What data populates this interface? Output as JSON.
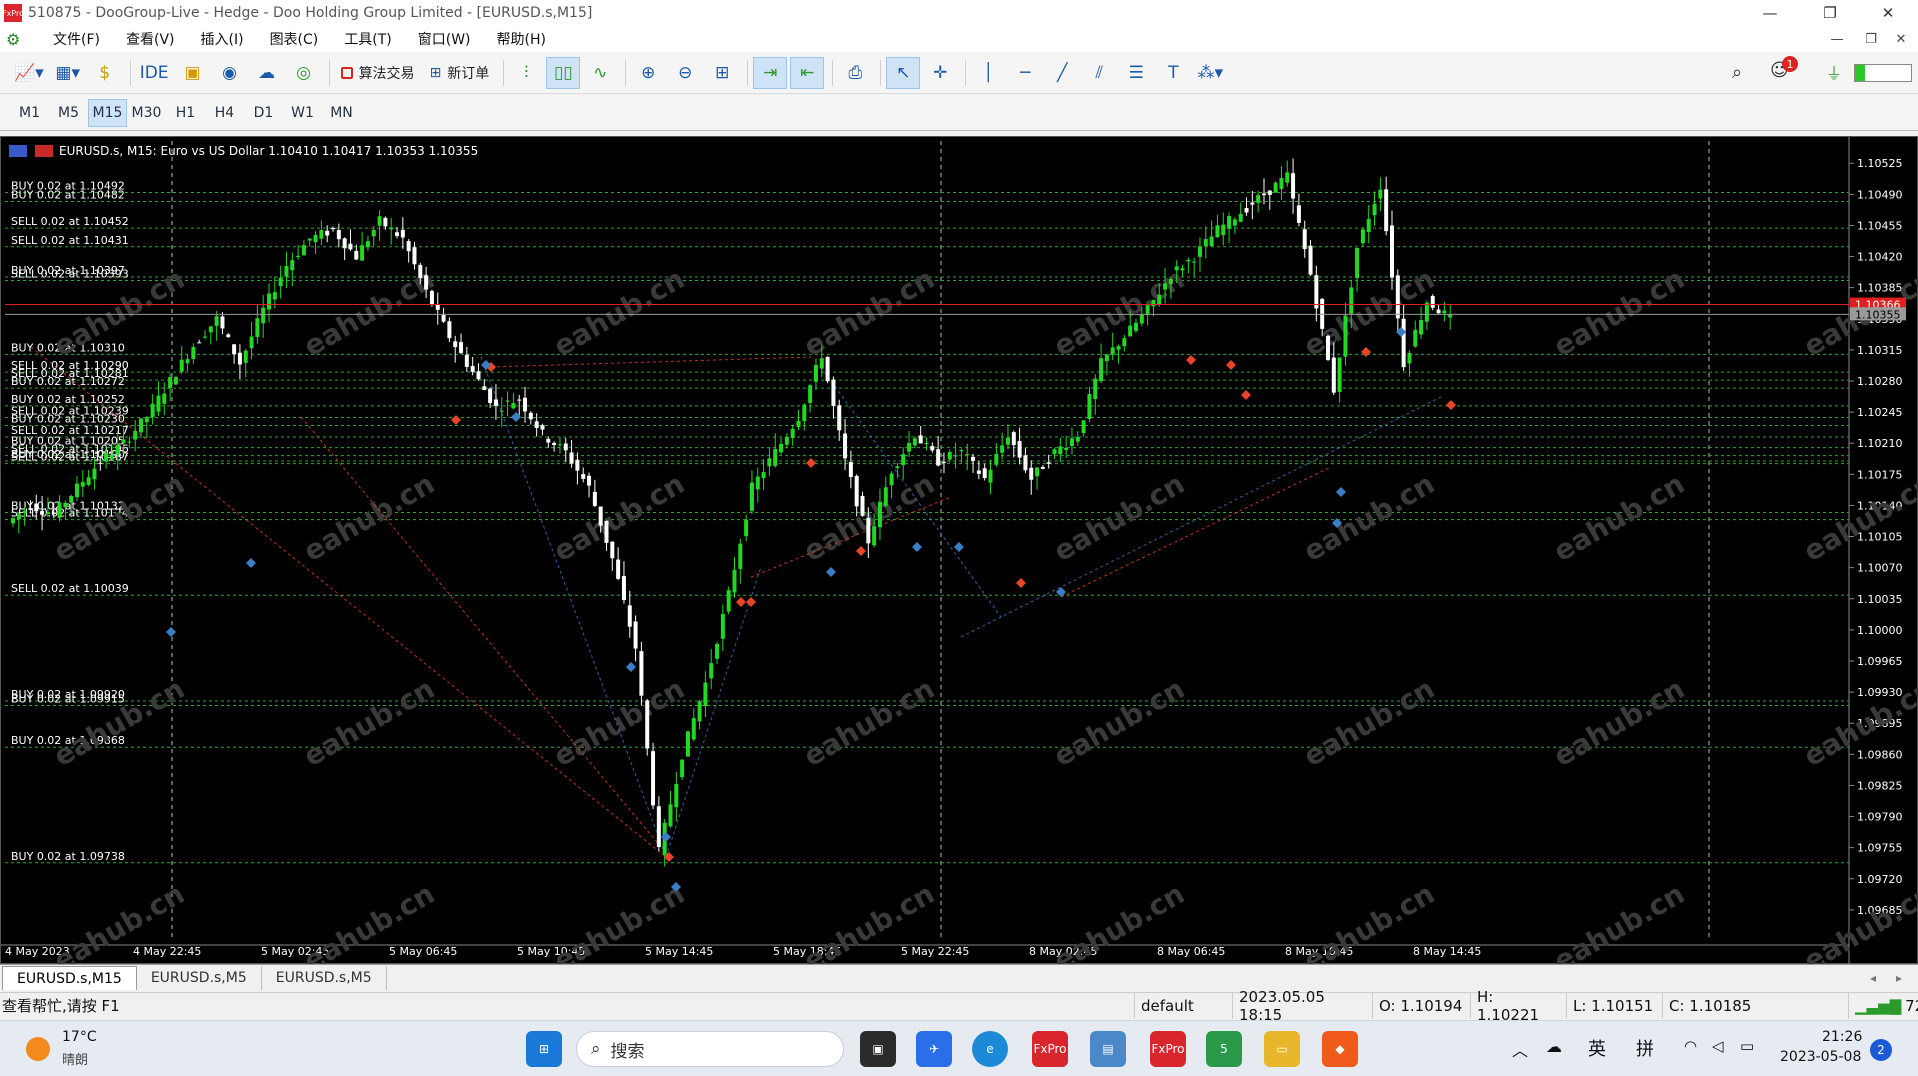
{
  "titlebar": {
    "title": "510875 - DooGroup-Live - Hedge - Doo Holding Group Limited - [EURUSD.s,M15]",
    "min": "—",
    "restore": "❐",
    "close": "✕"
  },
  "menu": {
    "items": [
      "文件(F)",
      "查看(V)",
      "插入(I)",
      "图表(C)",
      "工具(T)",
      "窗口(W)",
      "帮助(H)"
    ],
    "doc_min": "—",
    "doc_restore": "❐",
    "doc_close": "✕"
  },
  "toolbar": {
    "ide": "IDE",
    "algo_trading": "算法交易",
    "new_order": "新订单",
    "notif_count": "1"
  },
  "timeframes": {
    "items": [
      "M1",
      "M5",
      "M15",
      "M30",
      "H1",
      "H4",
      "D1",
      "W1",
      "MN"
    ],
    "active": "M15"
  },
  "chart_data": {
    "type": "candlestick",
    "symbol_header": "EURUSD.s, M15:  Euro vs US Dollar  1.10410 1.10417 1.10353 1.10355",
    "ylim": [
      1.0965,
      1.1055
    ],
    "y_ticks": [
      "1.10525",
      "1.10490",
      "1.10455",
      "1.10420",
      "1.10385",
      "1.10350",
      "1.10315",
      "1.10280",
      "1.10245",
      "1.10210",
      "1.10175",
      "1.10140",
      "1.10105",
      "1.10070",
      "1.10035",
      "1.10000",
      "1.09965",
      "1.09930",
      "1.09895",
      "1.09860",
      "1.09825",
      "1.09790",
      "1.09755",
      "1.09720",
      "1.09685"
    ],
    "x_ticks": [
      "4 May 2023",
      "4 May 22:45",
      "5 May 02:45",
      "5 May 06:45",
      "5 May 10:45",
      "5 May 14:45",
      "5 May 18:45",
      "5 May 22:45",
      "8 May 02:45",
      "8 May 06:45",
      "8 May 10:45",
      "8 May 14:45"
    ],
    "price_labels": {
      "ask": "1.10366",
      "bid": "1.10355"
    },
    "order_lines": [
      {
        "label": "BUY 0.02 at 1.10492",
        "price": 1.10492
      },
      {
        "label": "BUY 0.02 at 1.10482",
        "price": 1.10482
      },
      {
        "label": "SELL 0.02 at 1.10452",
        "price": 1.10452
      },
      {
        "label": "SELL 0.02 at 1.10431",
        "price": 1.10431
      },
      {
        "label": "BUY 0.02 at 1.10397",
        "price": 1.10397
      },
      {
        "label": "SELL 0.02 at 1.10393",
        "price": 1.10393
      },
      {
        "label": "BUY 0.02 at 1.10310",
        "price": 1.1031
      },
      {
        "label": "SELL 0.02 at 1.10290",
        "price": 1.1029
      },
      {
        "label": "SELL 0.02 at 1.10281",
        "price": 1.10281
      },
      {
        "label": "BUY 0.02 at 1.10272",
        "price": 1.10272
      },
      {
        "label": "BUY 0.02 at 1.10252",
        "price": 1.10252
      },
      {
        "label": "SELL 0.02 at 1.10239",
        "price": 1.10239
      },
      {
        "label": "BUY 0.02 at 1.10230",
        "price": 1.1023
      },
      {
        "label": "SELL 0.02 at 1.10217",
        "price": 1.10217
      },
      {
        "label": "BUY 0.02 at 1.10205",
        "price": 1.10205
      },
      {
        "label": "SELL 0.02 at 1.10196",
        "price": 1.10196
      },
      {
        "label": "BUY 0.02 at 1.10190",
        "price": 1.1019
      },
      {
        "label": "SELL 0.02 at 1.10187",
        "price": 1.10187
      },
      {
        "label": "BUY 0.02 at 1.10132",
        "price": 1.10132
      },
      {
        "label": "SELL 0.02 at 1.10124",
        "price": 1.10124
      },
      {
        "label": "SELL 0.02 at 1.10039",
        "price": 1.10039
      },
      {
        "label": "BUY 0.02 at 1.09920",
        "price": 1.0992
      },
      {
        "label": "BUY 0.02 at 1.09915",
        "price": 1.09915
      },
      {
        "label": "BUY 0.02 at 1.09868",
        "price": 1.09868
      },
      {
        "label": "BUY 0.02 at 1.09738",
        "price": 1.09738
      }
    ],
    "close_path": [
      1.1012,
      1.1014,
      1.1013,
      1.1016,
      1.1019,
      1.1021,
      1.1024,
      1.1028,
      1.1032,
      1.1035,
      1.103,
      1.1036,
      1.1041,
      1.1044,
      1.1045,
      1.1042,
      1.1046,
      1.1044,
      1.1038,
      1.1033,
      1.1029,
      1.1025,
      1.1026,
      1.1022,
      1.102,
      1.1016,
      1.1008,
      1.0998,
      1.0975,
      1.0986,
      1.0994,
      1.1004,
      1.1016,
      1.102,
      1.1024,
      1.1031,
      1.1019,
      1.101,
      1.1018,
      1.1022,
      1.1019,
      1.102,
      1.1017,
      1.1022,
      1.1017,
      1.102,
      1.1022,
      1.103,
      1.1033,
      1.1036,
      1.104,
      1.1042,
      1.1045,
      1.1047,
      1.1049,
      1.1051,
      1.104,
      1.1027,
      1.1043,
      1.105,
      1.103,
      1.1037,
      1.1035
    ],
    "colors": {
      "bull": "#22d822",
      "bear": "#ffffff",
      "grid": "#4a4a4a",
      "order_line": "#2ea82e",
      "buy": "#3a7ec8",
      "sell": "#e8442a"
    }
  },
  "watermark": "eahub.cn",
  "tabs": [
    "EURUSD.s,M15",
    "EURUSD.s,M5",
    "EURUSD.s,M5"
  ],
  "status": {
    "help": "查看帮忙,请按 F1",
    "profile": "default",
    "datetime": "2023.05.05 18:15",
    "open": "O: 1.10194",
    "high": "H: 1.10221",
    "low": "L: 1.10151",
    "close": "C: 1.10185",
    "signal": "72.0"
  },
  "taskbar": {
    "weather_temp": "17°C",
    "weather_desc": "晴朗",
    "search": "搜索",
    "lang1": "英",
    "lang2": "拼",
    "time": "21:26",
    "date": "2023-05-08",
    "badge": "2"
  }
}
